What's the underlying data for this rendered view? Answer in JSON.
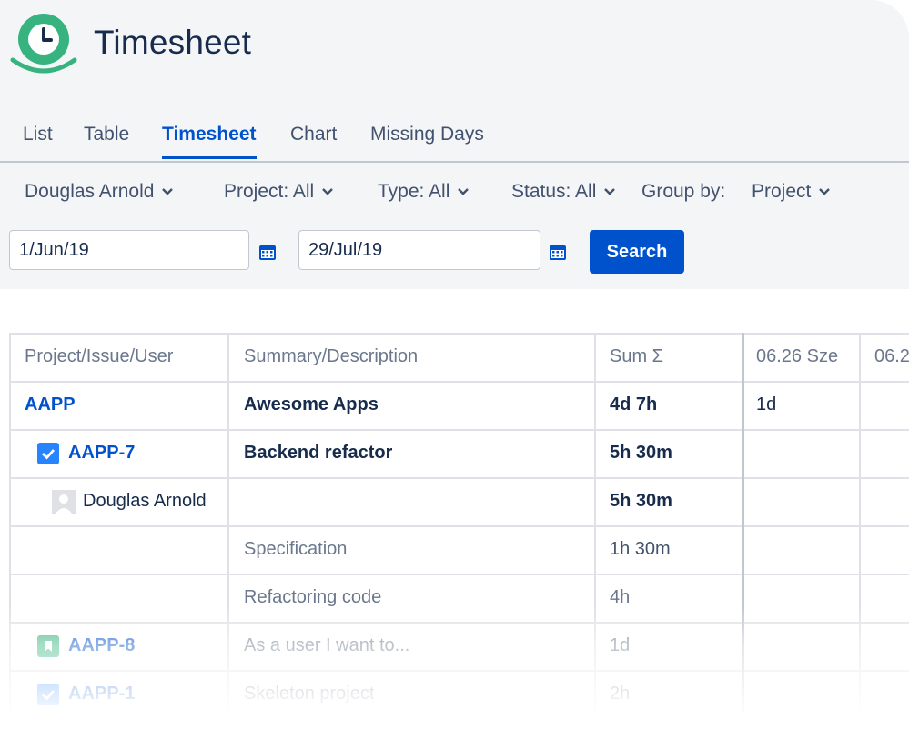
{
  "app": {
    "title": "Timesheet",
    "logo_icon": "clock-icon",
    "brand_color": "#36b37e"
  },
  "tabs": [
    {
      "label": "List",
      "active": false
    },
    {
      "label": "Table",
      "active": false
    },
    {
      "label": "Timesheet",
      "active": true
    },
    {
      "label": "Chart",
      "active": false
    },
    {
      "label": "Missing Days",
      "active": false
    }
  ],
  "filters": {
    "user": "Douglas Arnold",
    "project": "Project: All",
    "type": "Type: All",
    "status": "Status: All",
    "group_by_label": "Group by:",
    "group_by_value": "Project"
  },
  "dates": {
    "from": "1/Jun/19",
    "to": "29/Jul/19"
  },
  "search_label": "Search",
  "accent_color": "#0052cc",
  "table": {
    "headers": [
      "Project/Issue/User",
      "Summary/Description",
      "Sum Σ",
      "06.26 Sze",
      "06.2"
    ],
    "rows": [
      {
        "key": "AAPP",
        "summary": "Awesome Apps",
        "sum": "4d 7h",
        "d1": "1d"
      },
      {
        "key": "AAPP-7",
        "icon": "checkbox-icon",
        "summary": "Backend refactor",
        "sum": "5h 30m",
        "d1": ""
      },
      {
        "key": "Douglas Arnold",
        "icon": "avatar-icon",
        "summary": "",
        "sum": "5h 30m",
        "d1": ""
      },
      {
        "key": "",
        "summary": "Specification",
        "sum": "1h 30m",
        "d1": ""
      },
      {
        "key": "",
        "summary": "Refactoring code",
        "sum": "4h",
        "d1": ""
      },
      {
        "key": "AAPP-8",
        "icon": "story-icon",
        "summary": "As a user I want to...",
        "sum": "1d",
        "d1": ""
      },
      {
        "key": "AAPP-1",
        "icon": "checkbox-icon",
        "summary": "Skeleton project",
        "sum": "2h",
        "d1": ""
      }
    ]
  }
}
